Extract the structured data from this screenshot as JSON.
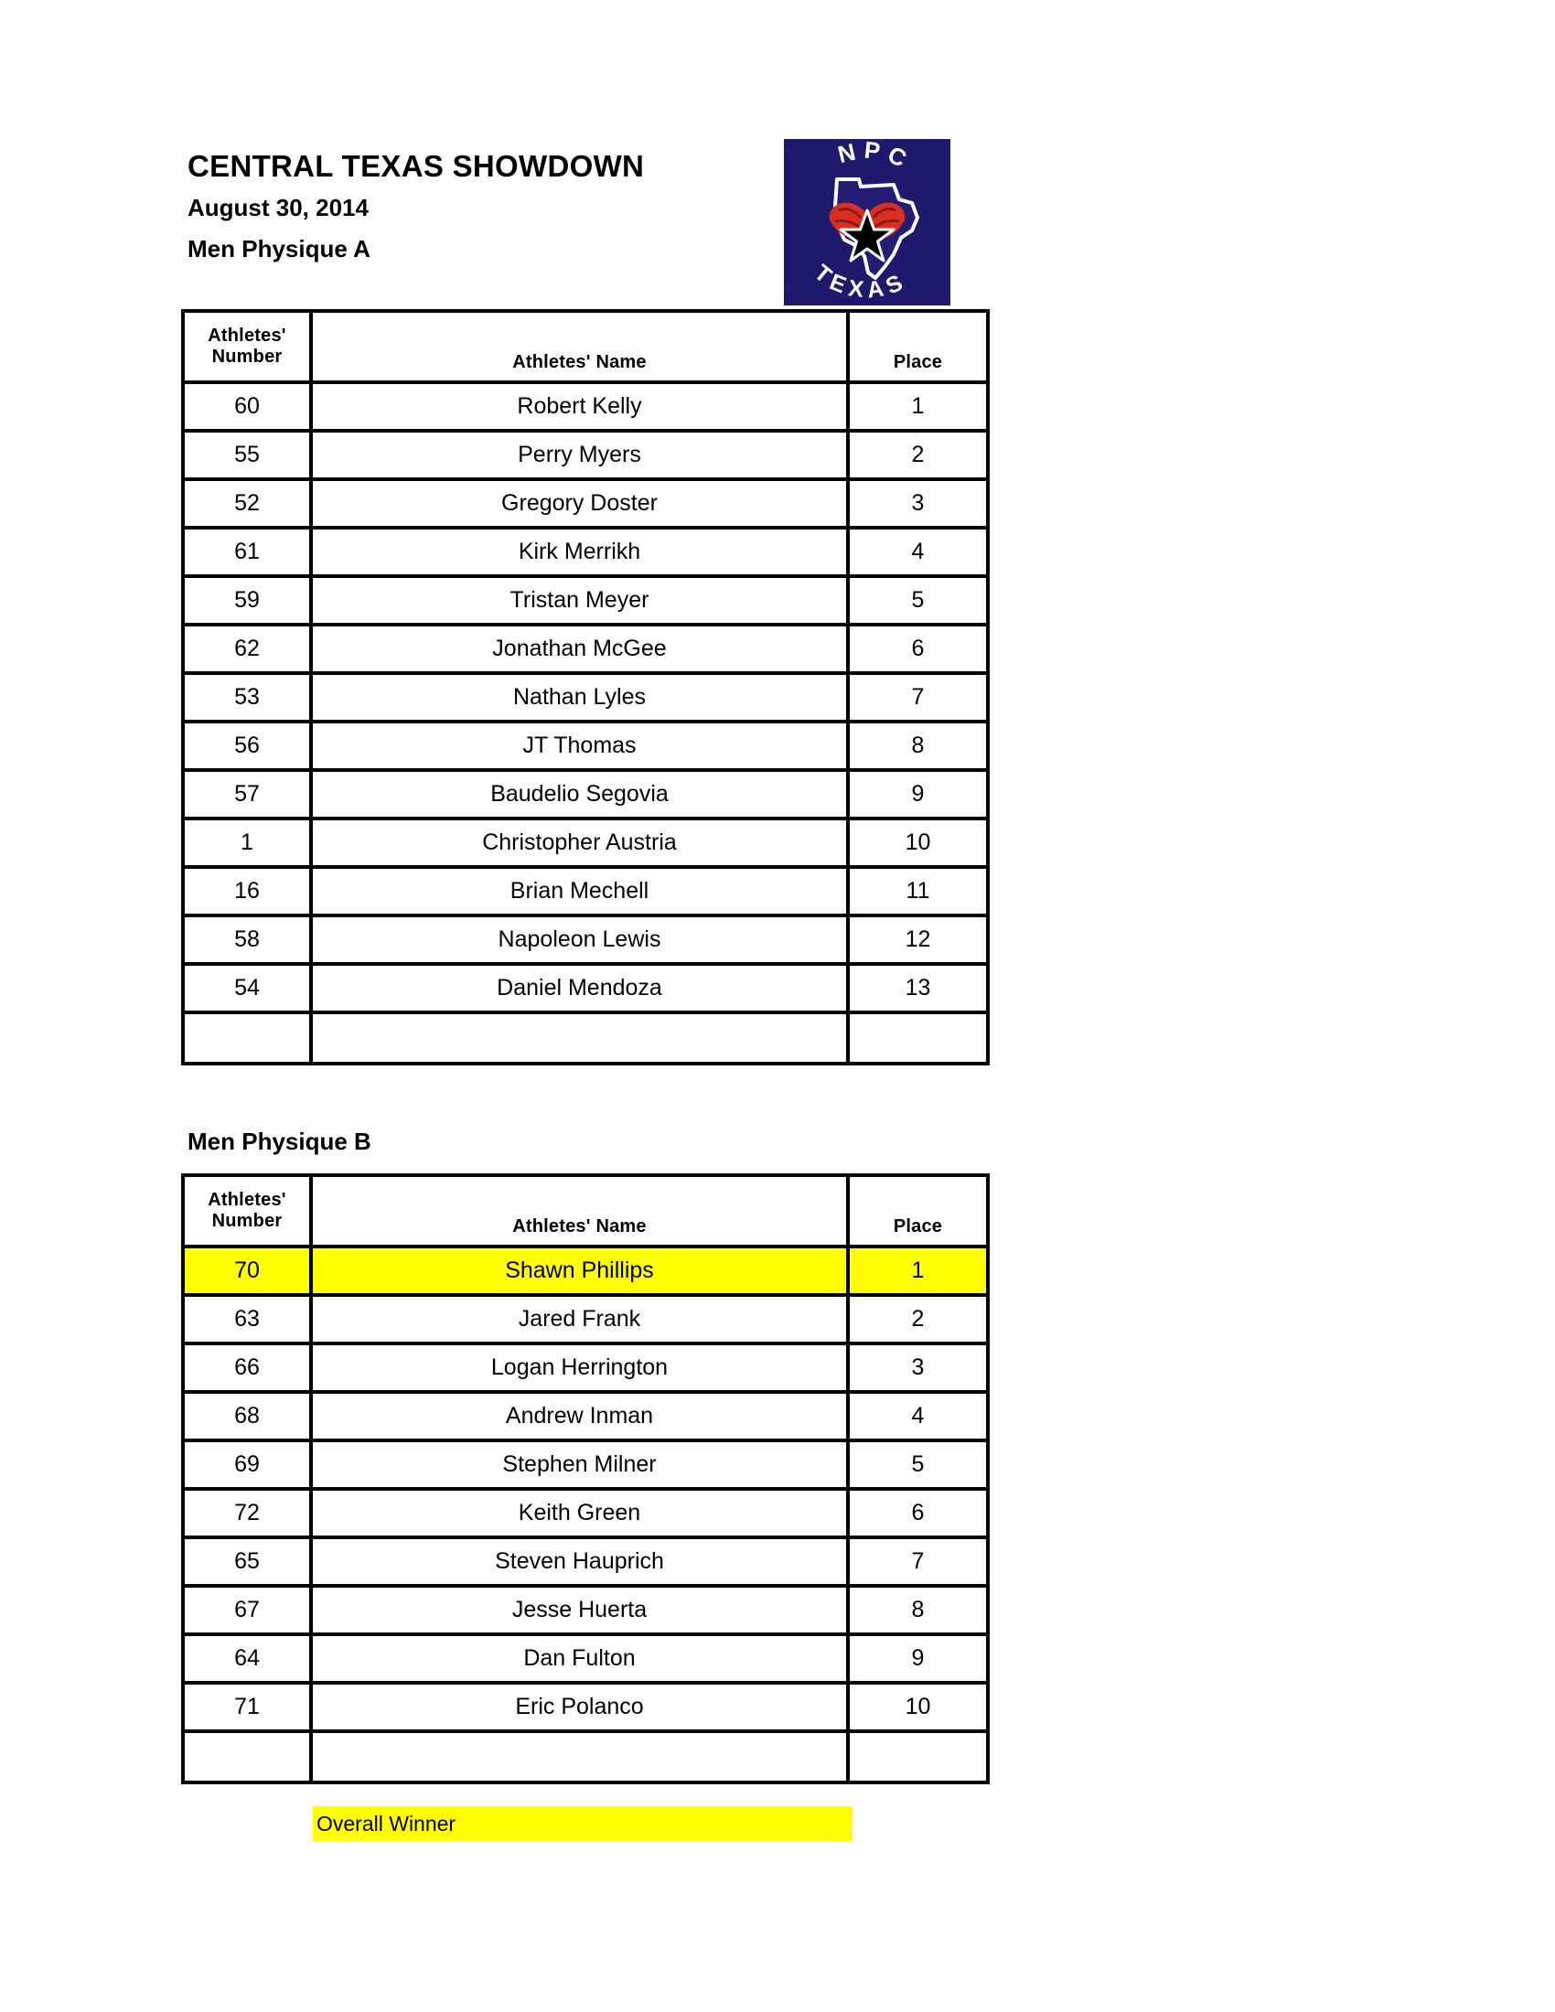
{
  "document": {
    "title": "CENTRAL TEXAS SHOWDOWN",
    "date": "August 30, 2014",
    "class_a_label": "Men Physique A",
    "class_b_label": "Men Physique B"
  },
  "logo": {
    "name": "npc-texas-logo",
    "top_text": "NPC",
    "bottom_text": "TEXAS",
    "background_color": "#1f1a6e",
    "glove_color": "#d82f22",
    "outline_color": "#ffffff",
    "star_color": "#000000"
  },
  "table_headers": {
    "number": "Athletes' Number",
    "number_line1": "Athletes'",
    "number_line2": "Number",
    "name": "Athletes' Name",
    "place": "Place"
  },
  "tables": [
    {
      "id": "men-physique-a",
      "caption": "Men Physique A",
      "rows": [
        {
          "number": "60",
          "name": "Robert Kelly",
          "place": "1",
          "winner": false
        },
        {
          "number": "55",
          "name": "Perry Myers",
          "place": "2",
          "winner": false
        },
        {
          "number": "52",
          "name": "Gregory Doster",
          "place": "3",
          "winner": false
        },
        {
          "number": "61",
          "name": "Kirk Merrikh",
          "place": "4",
          "winner": false
        },
        {
          "number": "59",
          "name": "Tristan Meyer",
          "place": "5",
          "winner": false
        },
        {
          "number": "62",
          "name": "Jonathan McGee",
          "place": "6",
          "winner": false
        },
        {
          "number": "53",
          "name": "Nathan Lyles",
          "place": "7",
          "winner": false
        },
        {
          "number": "56",
          "name": "JT Thomas",
          "place": "8",
          "winner": false
        },
        {
          "number": "57",
          "name": "Baudelio Segovia",
          "place": "9",
          "winner": false
        },
        {
          "number": "1",
          "name": "Christopher Austria",
          "place": "10",
          "winner": false
        },
        {
          "number": "16",
          "name": "Brian Mechell",
          "place": "11",
          "winner": false
        },
        {
          "number": "58",
          "name": "Napoleon Lewis",
          "place": "12",
          "winner": false
        },
        {
          "number": "54",
          "name": "Daniel Mendoza",
          "place": "13",
          "winner": false
        },
        {
          "number": "",
          "name": "",
          "place": "",
          "winner": false
        }
      ]
    },
    {
      "id": "men-physique-b",
      "caption": "Men Physique B",
      "rows": [
        {
          "number": "70",
          "name": "Shawn Phillips",
          "place": "1",
          "winner": true
        },
        {
          "number": "63",
          "name": "Jared Frank",
          "place": "2",
          "winner": false
        },
        {
          "number": "66",
          "name": "Logan Herrington",
          "place": "3",
          "winner": false
        },
        {
          "number": "68",
          "name": "Andrew Inman",
          "place": "4",
          "winner": false
        },
        {
          "number": "69",
          "name": "Stephen Milner",
          "place": "5",
          "winner": false
        },
        {
          "number": "72",
          "name": "Keith Green",
          "place": "6",
          "winner": false
        },
        {
          "number": "65",
          "name": "Steven Hauprich",
          "place": "7",
          "winner": false
        },
        {
          "number": "67",
          "name": "Jesse Huerta",
          "place": "8",
          "winner": false
        },
        {
          "number": "64",
          "name": "Dan Fulton",
          "place": "9",
          "winner": false
        },
        {
          "number": "71",
          "name": "Eric Polanco",
          "place": "10",
          "winner": false
        },
        {
          "number": "",
          "name": "",
          "place": "",
          "winner": false
        }
      ]
    }
  ],
  "legend": {
    "label": "Overall Winner",
    "highlight_color": "#ffff00"
  }
}
